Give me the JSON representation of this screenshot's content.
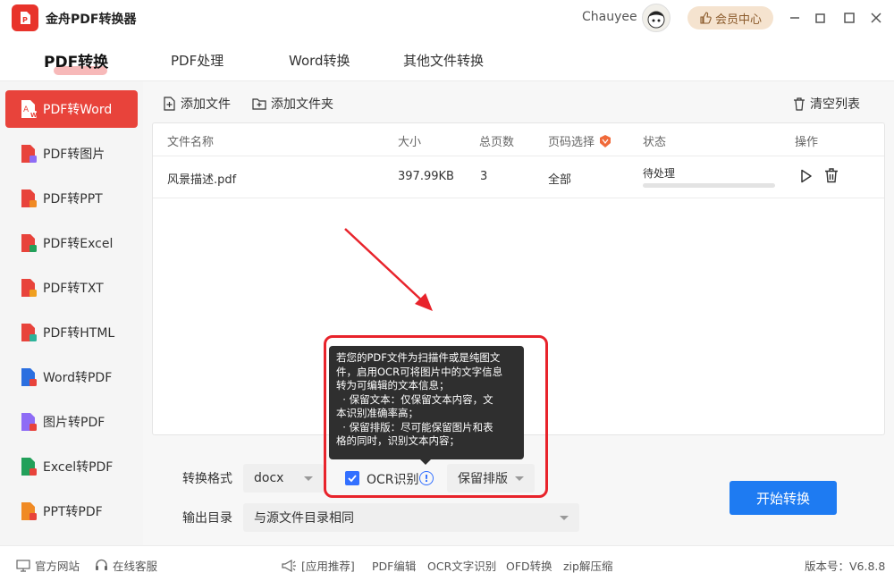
{
  "app": {
    "title": "金舟PDF转换器",
    "username": "Chauyee",
    "vip_label": "会员中心",
    "accent": "#e8433b",
    "primary": "#1e7bf2"
  },
  "topnav": {
    "tabs": [
      {
        "label": "PDF转换",
        "active": true
      },
      {
        "label": "PDF处理"
      },
      {
        "label": "Word转换"
      },
      {
        "label": "其他文件转换"
      }
    ]
  },
  "sidebar": {
    "items": [
      {
        "label": "PDF转Word",
        "active": true,
        "badge_color": "#e8433b"
      },
      {
        "label": "PDF转图片",
        "badge_color": "#8e6cf5"
      },
      {
        "label": "PDF转PPT",
        "badge_color": "#f08a24"
      },
      {
        "label": "PDF转Excel",
        "badge_color": "#22a05a"
      },
      {
        "label": "PDF转TXT",
        "badge_color": "#f0a020"
      },
      {
        "label": "PDF转HTML",
        "badge_color": "#2cb39a"
      },
      {
        "label": "Word转PDF",
        "badge_color": "#2b6fe0"
      },
      {
        "label": "图片转PDF",
        "badge_color": "#8e6cf5"
      },
      {
        "label": "Excel转PDF",
        "badge_color": "#22a05a"
      },
      {
        "label": "PPT转PDF",
        "badge_color": "#f08a24"
      }
    ]
  },
  "toolbar": {
    "add_file": "添加文件",
    "add_folder": "添加文件夹",
    "clear_list": "清空列表"
  },
  "table": {
    "headers": {
      "name": "文件名称",
      "size": "大小",
      "pages": "总页数",
      "page_select": "页码选择",
      "status": "状态",
      "actions": "操作"
    },
    "rows": [
      {
        "name": "风景描述.pdf",
        "size": "397.99KB",
        "pages": "3",
        "page_select": "全部",
        "status": "待处理",
        "progress": 0
      }
    ]
  },
  "settings": {
    "format_label": "转换格式",
    "format_value": "docx",
    "ocr_label": "OCR识别",
    "ocr_checked": true,
    "ocr_mode": "保留排版",
    "output_label": "输出目录",
    "output_value": "与源文件目录相同",
    "start_button": "开始转换"
  },
  "tooltip": {
    "lines": [
      "若您的PDF文件为扫描件或是纯图文",
      "件，启用OCR可将图片中的文字信息",
      "转为可编辑的文本信息；",
      "  · 保留文本：仅保留文本内容，文",
      "本识别准确率高；",
      "  · 保留排版：尽可能保留图片和表",
      "格的同时，识别文本内容；"
    ]
  },
  "statusbar": {
    "website": "官方网站",
    "support": "在线客服",
    "recommend": "[应用推荐]",
    "links": [
      "PDF编辑",
      "OCR文字识别",
      "OFD转换",
      "zip解压缩"
    ],
    "version": "版本号：V6.8.8"
  }
}
